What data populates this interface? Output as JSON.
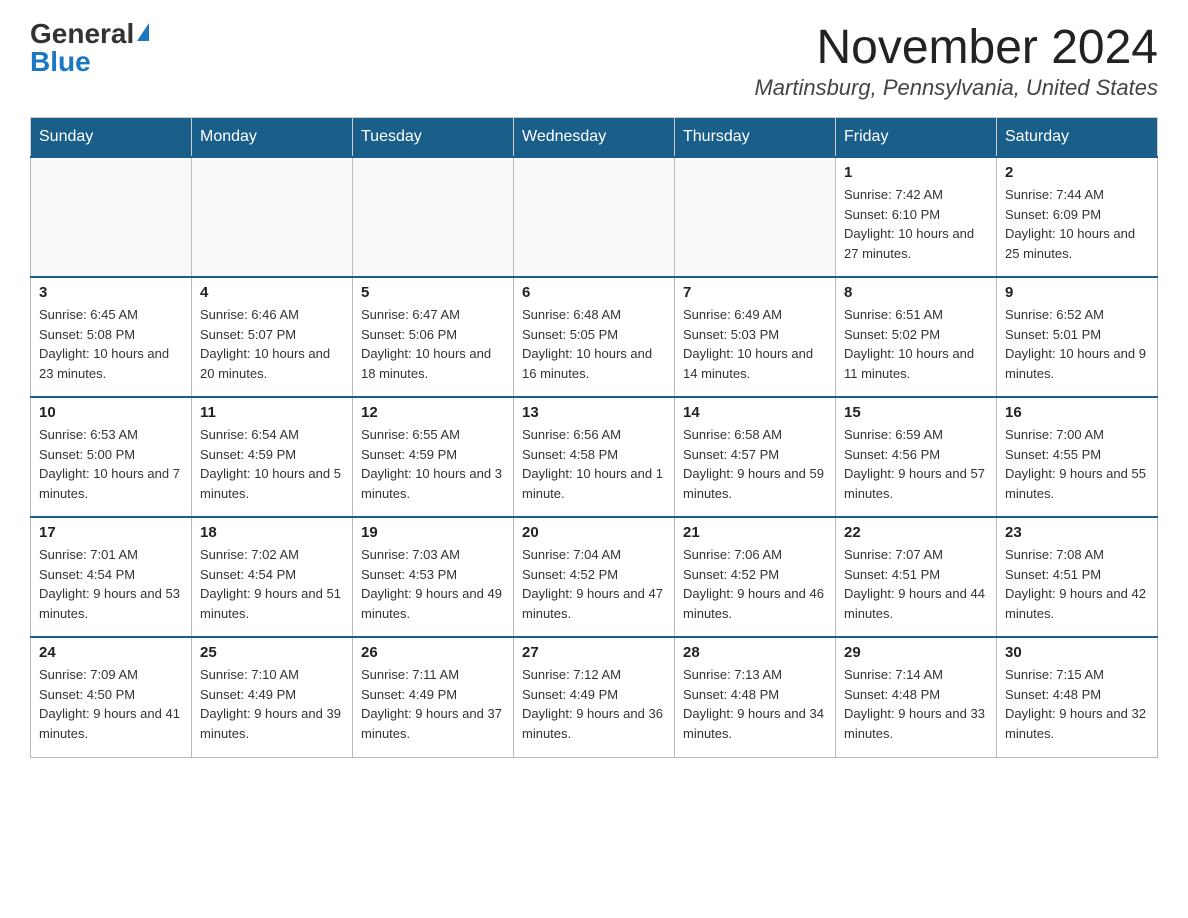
{
  "logo": {
    "general": "General",
    "blue": "Blue"
  },
  "title": "November 2024",
  "subtitle": "Martinsburg, Pennsylvania, United States",
  "days_of_week": [
    "Sunday",
    "Monday",
    "Tuesday",
    "Wednesday",
    "Thursday",
    "Friday",
    "Saturday"
  ],
  "weeks": [
    [
      {
        "day": "",
        "details": ""
      },
      {
        "day": "",
        "details": ""
      },
      {
        "day": "",
        "details": ""
      },
      {
        "day": "",
        "details": ""
      },
      {
        "day": "",
        "details": ""
      },
      {
        "day": "1",
        "details": "Sunrise: 7:42 AM\nSunset: 6:10 PM\nDaylight: 10 hours and 27 minutes."
      },
      {
        "day": "2",
        "details": "Sunrise: 7:44 AM\nSunset: 6:09 PM\nDaylight: 10 hours and 25 minutes."
      }
    ],
    [
      {
        "day": "3",
        "details": "Sunrise: 6:45 AM\nSunset: 5:08 PM\nDaylight: 10 hours and 23 minutes."
      },
      {
        "day": "4",
        "details": "Sunrise: 6:46 AM\nSunset: 5:07 PM\nDaylight: 10 hours and 20 minutes."
      },
      {
        "day": "5",
        "details": "Sunrise: 6:47 AM\nSunset: 5:06 PM\nDaylight: 10 hours and 18 minutes."
      },
      {
        "day": "6",
        "details": "Sunrise: 6:48 AM\nSunset: 5:05 PM\nDaylight: 10 hours and 16 minutes."
      },
      {
        "day": "7",
        "details": "Sunrise: 6:49 AM\nSunset: 5:03 PM\nDaylight: 10 hours and 14 minutes."
      },
      {
        "day": "8",
        "details": "Sunrise: 6:51 AM\nSunset: 5:02 PM\nDaylight: 10 hours and 11 minutes."
      },
      {
        "day": "9",
        "details": "Sunrise: 6:52 AM\nSunset: 5:01 PM\nDaylight: 10 hours and 9 minutes."
      }
    ],
    [
      {
        "day": "10",
        "details": "Sunrise: 6:53 AM\nSunset: 5:00 PM\nDaylight: 10 hours and 7 minutes."
      },
      {
        "day": "11",
        "details": "Sunrise: 6:54 AM\nSunset: 4:59 PM\nDaylight: 10 hours and 5 minutes."
      },
      {
        "day": "12",
        "details": "Sunrise: 6:55 AM\nSunset: 4:59 PM\nDaylight: 10 hours and 3 minutes."
      },
      {
        "day": "13",
        "details": "Sunrise: 6:56 AM\nSunset: 4:58 PM\nDaylight: 10 hours and 1 minute."
      },
      {
        "day": "14",
        "details": "Sunrise: 6:58 AM\nSunset: 4:57 PM\nDaylight: 9 hours and 59 minutes."
      },
      {
        "day": "15",
        "details": "Sunrise: 6:59 AM\nSunset: 4:56 PM\nDaylight: 9 hours and 57 minutes."
      },
      {
        "day": "16",
        "details": "Sunrise: 7:00 AM\nSunset: 4:55 PM\nDaylight: 9 hours and 55 minutes."
      }
    ],
    [
      {
        "day": "17",
        "details": "Sunrise: 7:01 AM\nSunset: 4:54 PM\nDaylight: 9 hours and 53 minutes."
      },
      {
        "day": "18",
        "details": "Sunrise: 7:02 AM\nSunset: 4:54 PM\nDaylight: 9 hours and 51 minutes."
      },
      {
        "day": "19",
        "details": "Sunrise: 7:03 AM\nSunset: 4:53 PM\nDaylight: 9 hours and 49 minutes."
      },
      {
        "day": "20",
        "details": "Sunrise: 7:04 AM\nSunset: 4:52 PM\nDaylight: 9 hours and 47 minutes."
      },
      {
        "day": "21",
        "details": "Sunrise: 7:06 AM\nSunset: 4:52 PM\nDaylight: 9 hours and 46 minutes."
      },
      {
        "day": "22",
        "details": "Sunrise: 7:07 AM\nSunset: 4:51 PM\nDaylight: 9 hours and 44 minutes."
      },
      {
        "day": "23",
        "details": "Sunrise: 7:08 AM\nSunset: 4:51 PM\nDaylight: 9 hours and 42 minutes."
      }
    ],
    [
      {
        "day": "24",
        "details": "Sunrise: 7:09 AM\nSunset: 4:50 PM\nDaylight: 9 hours and 41 minutes."
      },
      {
        "day": "25",
        "details": "Sunrise: 7:10 AM\nSunset: 4:49 PM\nDaylight: 9 hours and 39 minutes."
      },
      {
        "day": "26",
        "details": "Sunrise: 7:11 AM\nSunset: 4:49 PM\nDaylight: 9 hours and 37 minutes."
      },
      {
        "day": "27",
        "details": "Sunrise: 7:12 AM\nSunset: 4:49 PM\nDaylight: 9 hours and 36 minutes."
      },
      {
        "day": "28",
        "details": "Sunrise: 7:13 AM\nSunset: 4:48 PM\nDaylight: 9 hours and 34 minutes."
      },
      {
        "day": "29",
        "details": "Sunrise: 7:14 AM\nSunset: 4:48 PM\nDaylight: 9 hours and 33 minutes."
      },
      {
        "day": "30",
        "details": "Sunrise: 7:15 AM\nSunset: 4:48 PM\nDaylight: 9 hours and 32 minutes."
      }
    ]
  ]
}
